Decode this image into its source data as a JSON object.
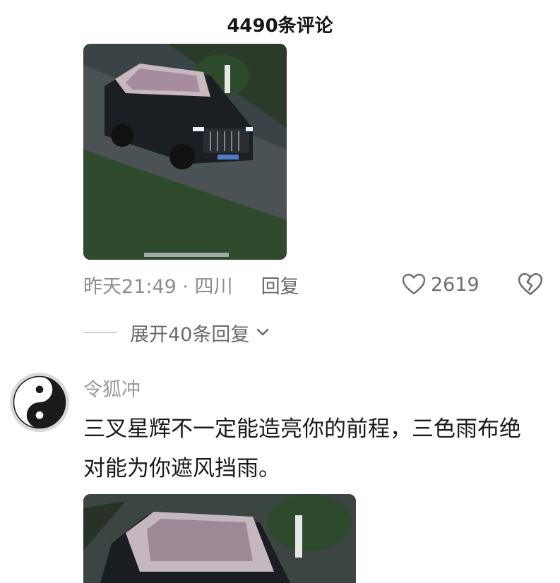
{
  "header": {
    "title": "4490条评论"
  },
  "comment1": {
    "photo_icon": "car-photo",
    "time_location": "昨天21:49 · 四川",
    "reply_label": "回复",
    "like_count": "2619",
    "like_icon": "heart-outline-icon",
    "dislike_icon": "broken-heart-icon"
  },
  "expand": {
    "label": "展开40条回复",
    "icon": "chevron-down-icon"
  },
  "comment2": {
    "avatar_icon": "yin-yang-icon",
    "username": "令狐冲",
    "text": "三叉星辉不一定能造亮你的前程，三色雨布绝对能为你遮风挡雨。",
    "photo_icon": "car-photo"
  },
  "colors": {
    "secondary_text": "#8d8d8d",
    "primary_text": "#1a1a1a",
    "divider": "#d0d0d0"
  }
}
